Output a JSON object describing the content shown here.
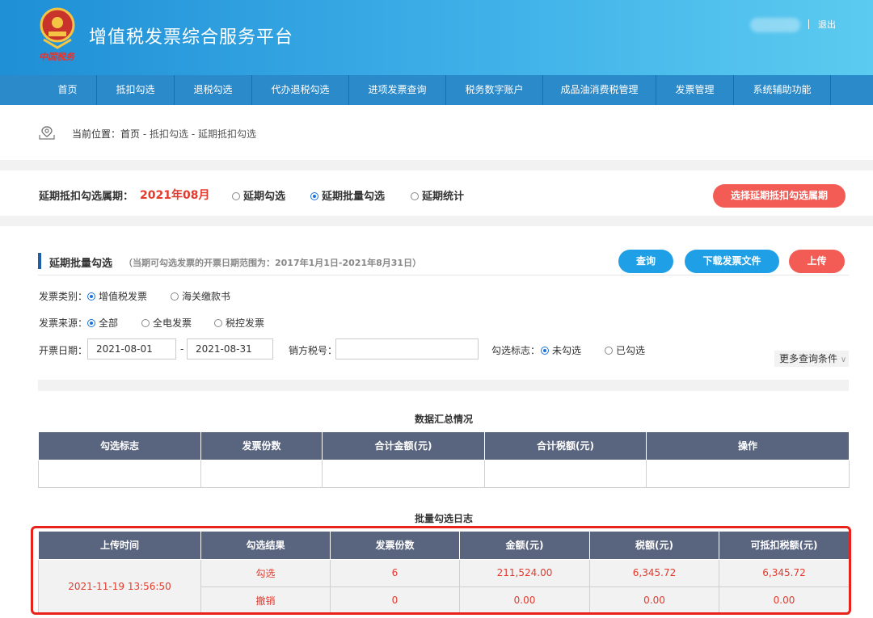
{
  "header": {
    "site_title": "增值税发票综合服务平台",
    "logo_sub": "中国税务",
    "logout": "退出"
  },
  "nav": {
    "items": [
      {
        "label": "首页"
      },
      {
        "label": "抵扣勾选"
      },
      {
        "label": "退税勾选"
      },
      {
        "label": "代办退税勾选"
      },
      {
        "label": "进项发票查询"
      },
      {
        "label": "税务数字账户"
      },
      {
        "label": "成品油消费税管理"
      },
      {
        "label": "发票管理"
      },
      {
        "label": "系统辅助功能"
      }
    ]
  },
  "breadcrumb": {
    "prefix": "当前位置：",
    "items": [
      "首页",
      "抵扣勾选",
      "延期抵扣勾选"
    ],
    "sep": " - "
  },
  "period": {
    "label": "延期抵扣勾选属期：",
    "value": "2021年08月",
    "options": [
      {
        "label": "延期勾选",
        "selected": false
      },
      {
        "label": "延期批量勾选",
        "selected": true
      },
      {
        "label": "延期统计",
        "selected": false
      }
    ],
    "select_button": "选择延期抵扣勾选属期"
  },
  "section": {
    "title": "延期批量勾选",
    "note": "（当期可勾选发票的开票日期范围为：2017年1月1日-2021年8月31日）",
    "buttons": {
      "query": "查询",
      "download": "下载发票文件",
      "upload": "上传"
    }
  },
  "filters": {
    "invoice_type": {
      "label": "发票类别：",
      "options": [
        {
          "label": "增值税发票",
          "selected": true
        },
        {
          "label": "海关缴款书",
          "selected": false
        }
      ]
    },
    "invoice_source": {
      "label": "发票来源：",
      "options": [
        {
          "label": "全部",
          "selected": true
        },
        {
          "label": "全电发票",
          "selected": false
        },
        {
          "label": "税控发票",
          "selected": false
        }
      ]
    },
    "date": {
      "label": "开票日期：",
      "from": "2021-08-01",
      "dash": "-",
      "to": "2021-08-31"
    },
    "seller_tax_no": {
      "label": "销方税号：",
      "value": ""
    },
    "check_flag": {
      "label": "勾选标志：",
      "options": [
        {
          "label": "未勾选",
          "selected": true
        },
        {
          "label": "已勾选",
          "selected": false
        }
      ]
    },
    "more": "更多查询条件"
  },
  "summary": {
    "caption": "数据汇总情况",
    "headers": [
      "勾选标志",
      "发票份数",
      "合计金额(元)",
      "合计税额(元)",
      "操作"
    ]
  },
  "log": {
    "caption": "批量勾选日志",
    "headers": [
      "上传时间",
      "勾选结果",
      "发票份数",
      "金额(元)",
      "税额(元)",
      "可抵扣税额(元)"
    ],
    "upload_time": "2021-11-19 13:56:50",
    "rows": [
      {
        "result": "勾选",
        "count": "6",
        "amount": "211,524.00",
        "tax": "6,345.72",
        "deductible": "6,345.72"
      },
      {
        "result": "撤销",
        "count": "0",
        "amount": "0.00",
        "tax": "0.00",
        "deductible": "0.00"
      }
    ]
  },
  "colors": {
    "accent_red": "#e23b2e",
    "header_blue": "#2b8ac9",
    "table_head": "#59647e",
    "button_blue": "#1fa0e6",
    "button_red": "#f25c54"
  }
}
